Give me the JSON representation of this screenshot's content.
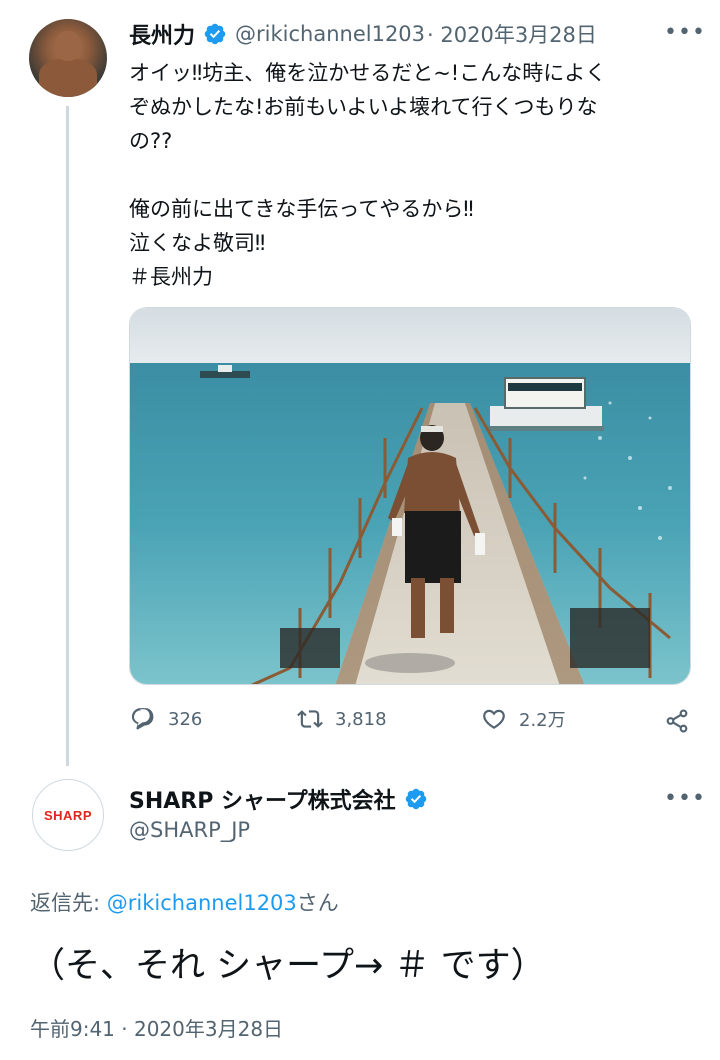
{
  "tweet1": {
    "author_name": "長州力",
    "handle": "@rikichannel1203",
    "date": " · 2020年3月28日",
    "more": "•••",
    "text": "オイッ‼坊主、俺を泣かせるだと~!こんな時によく\nぞぬかしたな!お前もいよいよ壊れて行くつもりな\nの??\n\n俺の前に出てきな手伝ってやるから‼\n泣くなよ敬司‼\n＃長州力",
    "image_alt": "",
    "reply_count": "326",
    "retweet_count": "3,818",
    "like_count": "2.2万",
    "icons": [
      "reply-icon",
      "retweet-icon",
      "like-icon",
      "share-icon"
    ]
  },
  "tweet2": {
    "author_name": "SHARP シャープ株式会社",
    "handle": "@SHARP_JP",
    "more": "•••",
    "logo_text": "SHARP",
    "reply_to_label": "返信先: ",
    "reply_to_handle": "@rikichannel1203",
    "reply_to_suffix": "さん",
    "text": "（そ、それ シャープ→ ＃ です）",
    "timestamp": "午前9:41 · 2020年3月28日"
  },
  "colors": {
    "accent": "#1d9bf0",
    "text": "#0f1419",
    "secondary": "#536471",
    "border": "#cfd9de",
    "brand_sharp": "#e1251b"
  }
}
